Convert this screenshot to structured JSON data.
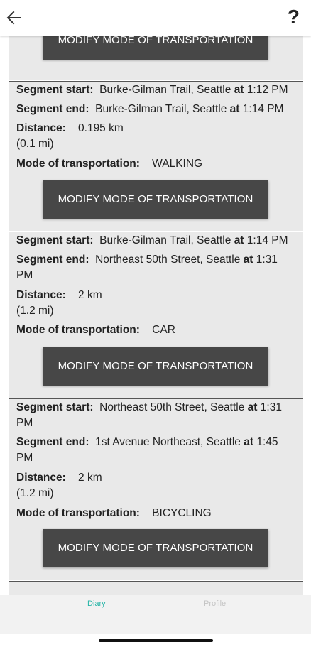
{
  "header": {
    "help_label": "?"
  },
  "button_label": "MODIFY MODE OF TRANSPORTATION",
  "labels": {
    "segment_start": "Segment start:",
    "segment_end": "Segment end:",
    "at": "at",
    "distance": "Distance:",
    "mode": "Mode of transportation:"
  },
  "segments": [
    {
      "start_place": "Burke-Gilman Trail, Seattle",
      "start_time": "1:12 PM",
      "end_place": "Burke-Gilman Trail, Seattle",
      "end_time": "1:14 PM",
      "distance_km": "0.195 km",
      "distance_mi": "(0.1 mi)",
      "mode": "WALKING"
    },
    {
      "start_place": "Burke-Gilman Trail, Seattle",
      "start_time": "1:14 PM",
      "end_place": "Northeast 50th Street, Seattle",
      "end_time_a": "1:31",
      "end_time_b": "PM",
      "distance_km": "2 km",
      "distance_mi": "(1.2 mi)",
      "mode": "CAR"
    },
    {
      "start_place": "Northeast 50th Street, Seattle",
      "start_time_a": "1:31",
      "start_time_b": "PM",
      "end_place": "1st Avenue Northeast, Seattle",
      "end_time_a": "1:45",
      "end_time_b": "PM",
      "distance_km": "2 km",
      "distance_mi": "(1.2 mi)",
      "mode": "BICYCLING"
    }
  ],
  "bottom_nav": {
    "tabs": [
      {
        "label": "Diary",
        "active": true,
        "color": "#26b5a7"
      },
      {
        "label": "Profile",
        "active": false,
        "color": "#c3c3c3"
      }
    ]
  }
}
